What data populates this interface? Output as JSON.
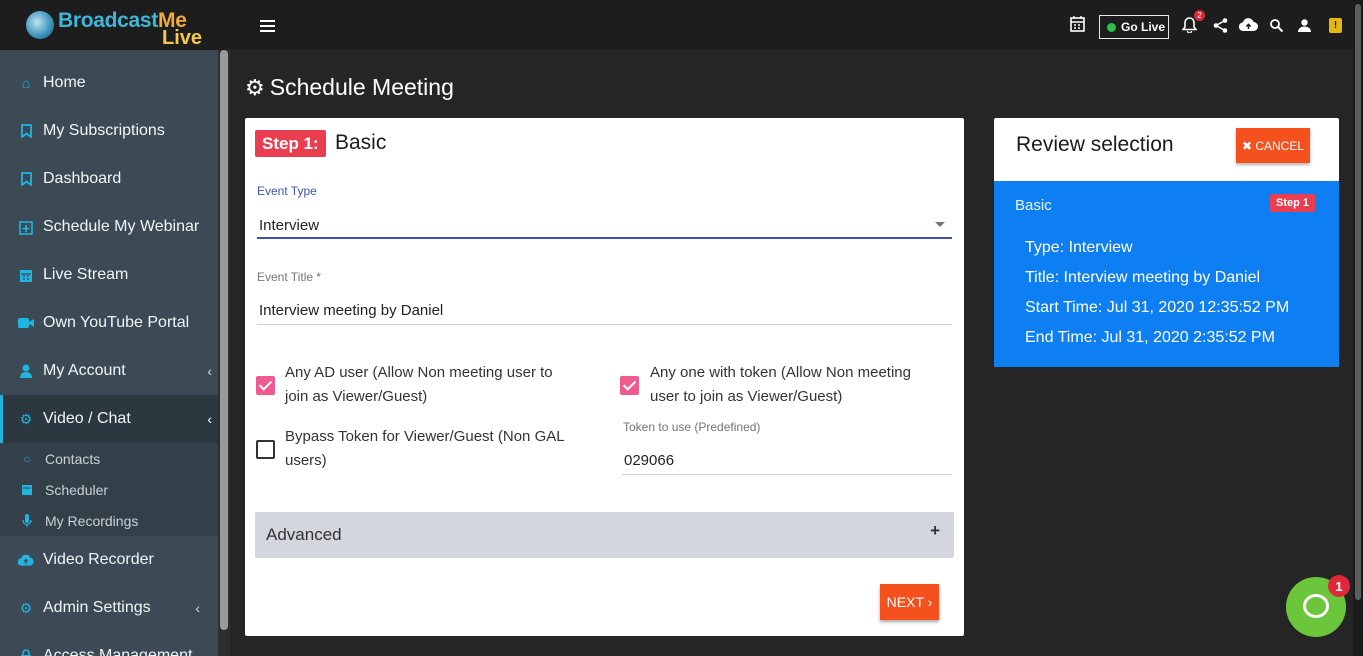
{
  "brand": {
    "name_part1": "Broadcast",
    "name_part2": "Me",
    "name_line2": "Live"
  },
  "sidebar": {
    "items": [
      {
        "label": "Home",
        "icon": "home-icon"
      },
      {
        "label": "My Subscriptions",
        "icon": "bookmark-icon"
      },
      {
        "label": "Dashboard",
        "icon": "bookmark-icon"
      },
      {
        "label": "Schedule My Webinar",
        "icon": "calendar-plus-icon"
      },
      {
        "label": "Live Stream",
        "icon": "calendar-icon"
      },
      {
        "label": "Own YouTube Portal",
        "icon": "video-camera-icon"
      },
      {
        "label": "My Account",
        "icon": "user-icon"
      },
      {
        "label": "Video / Chat",
        "icon": "cogs-icon"
      },
      {
        "label": "Video Recorder",
        "icon": "cloud-upload-icon"
      },
      {
        "label": "Admin Settings",
        "icon": "cogs-icon"
      },
      {
        "label": "Access Management",
        "icon": "lock-icon"
      }
    ],
    "submenu": [
      {
        "label": "Contacts",
        "icon": "circle-icon"
      },
      {
        "label": "Scheduler",
        "icon": "calendar-icon"
      },
      {
        "label": "My Recordings",
        "icon": "microphone-icon"
      }
    ]
  },
  "topbar": {
    "go_live_label": "Go Live",
    "notification_count": "2",
    "icons": [
      "calendar-icon",
      "bell-icon",
      "share-icon",
      "cloud-upload-icon",
      "search-icon",
      "user-icon",
      "hazard-icon"
    ]
  },
  "page": {
    "title": "Schedule Meeting"
  },
  "form": {
    "step_badge": "Step 1:",
    "step_title": "Basic",
    "event_type_label": "Event Type",
    "event_type_value": "Interview",
    "event_title_label": "Event Title *",
    "event_title_value": "Interview meeting by Daniel",
    "checkbox_ad_line1": "Any AD user (Allow Non meeting user to",
    "checkbox_ad_line2": "join as Viewer/Guest)",
    "checkbox_ad_checked": true,
    "checkbox_token_line1": "Any one with token (Allow Non meeting",
    "checkbox_token_line2": "user to join as Viewer/Guest)",
    "checkbox_token_checked": true,
    "checkbox_bypass_line1": "Bypass Token for Viewer/Guest (Non GAL",
    "checkbox_bypass_line2": "users)",
    "checkbox_bypass_checked": false,
    "token_label": "Token to use (Predefined)",
    "token_value": "029066",
    "advanced_label": "Advanced",
    "advanced_toggle": "+",
    "next_label": "NEXT ›"
  },
  "review": {
    "title": "Review selection",
    "cancel_label": "✖ CANCEL",
    "section": "Basic",
    "step_badge": "Step 1",
    "type_line": "Type: Interview",
    "title_line": "Title: Interview meeting by Daniel",
    "start_line": "Start Time: Jul 31, 2020 12:35:52 PM",
    "end_line": "End Time: Jul 31, 2020 2:35:52 PM"
  },
  "chat": {
    "badge_count": "1"
  },
  "colors": {
    "accent": "#22b3e0",
    "primary_button": "#f4511e",
    "review_blue": "#0d7ff2",
    "step_badge": "#e83e4f",
    "checkbox_pink": "#f05a8e"
  }
}
